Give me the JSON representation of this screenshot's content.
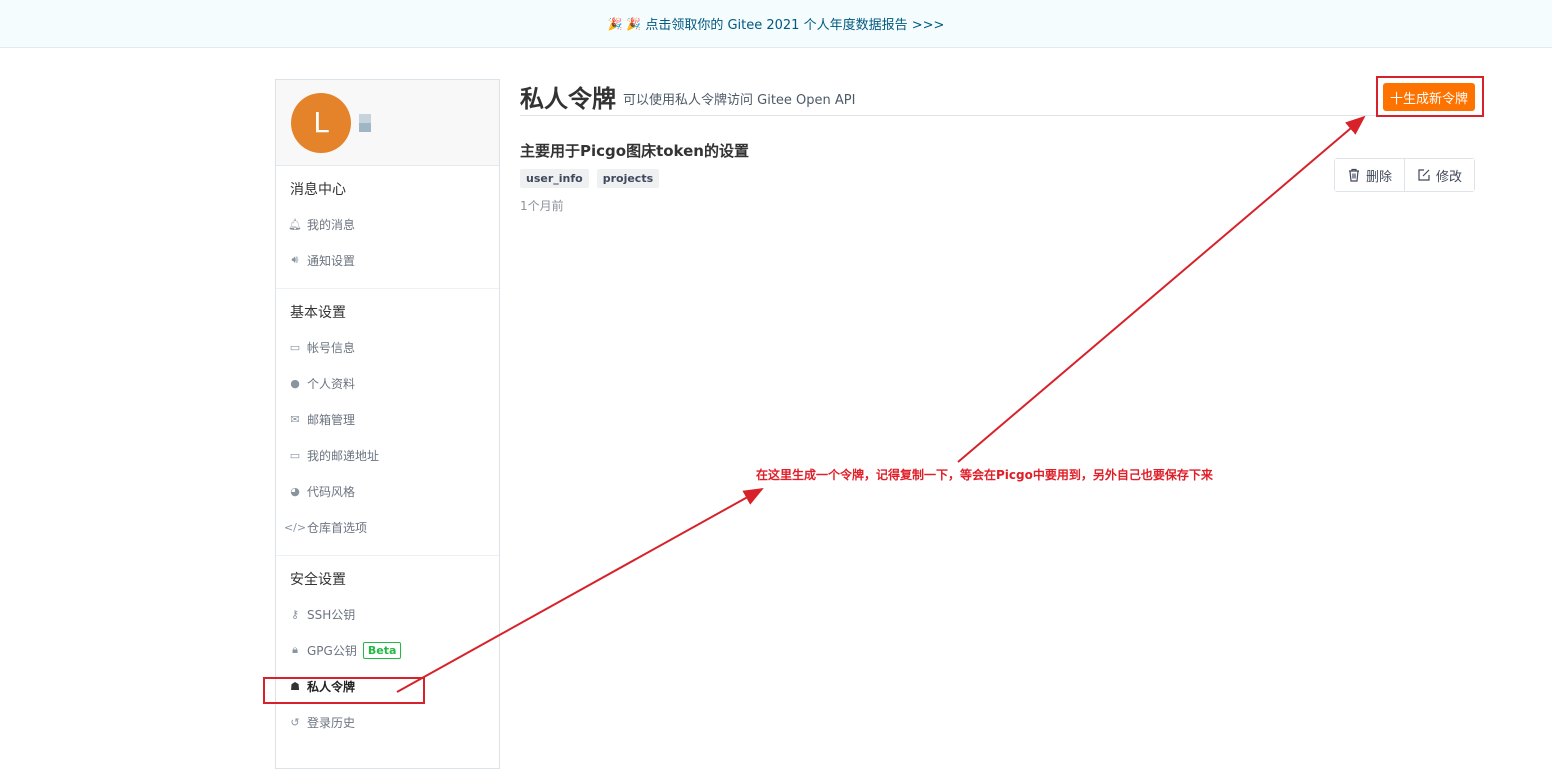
{
  "banner": {
    "emoji": "🎉 🎉",
    "text": "点击领取你的 Gitee 2021 个人年度数据报告 >>>"
  },
  "sidebar": {
    "avatar_letter": "L",
    "groups": [
      {
        "title": "消息中心",
        "items": [
          {
            "label": "我的消息",
            "icon": "bell-icon"
          },
          {
            "label": "通知设置",
            "icon": "volume-icon"
          }
        ]
      },
      {
        "title": "基本设置",
        "items": [
          {
            "label": "帐号信息",
            "icon": "id-card-icon"
          },
          {
            "label": "个人资料",
            "icon": "user-icon"
          },
          {
            "label": "邮箱管理",
            "icon": "envelope-icon"
          },
          {
            "label": "我的邮递地址",
            "icon": "address-card-icon"
          },
          {
            "label": "代码风格",
            "icon": "palette-icon"
          },
          {
            "label": "仓库首选项",
            "icon": "code-icon"
          }
        ]
      },
      {
        "title": "安全设置",
        "items": [
          {
            "label": "SSH公钥",
            "icon": "key-icon"
          },
          {
            "label": "GPG公钥",
            "icon": "lock-icon",
            "badge": "Beta"
          },
          {
            "label": "私人令牌",
            "icon": "user-secret-icon",
            "active": true
          },
          {
            "label": "登录历史",
            "icon": "history-icon"
          }
        ]
      }
    ]
  },
  "main": {
    "title": "私人令牌",
    "description": "可以使用私人令牌访问 Gitee Open API",
    "generate_button": "十生成新令牌",
    "token": {
      "name": "主要用于Picgo图床token的设置",
      "scopes": [
        "user_info",
        "projects"
      ],
      "time": "1个月前",
      "delete_label": "删除",
      "edit_label": "修改"
    }
  },
  "annotation": {
    "text": "在这里生成一个令牌，记得复制一下，等会在Picgo中要用到，另外自己也要保存下来",
    "color": "#e01e28"
  },
  "colors": {
    "accent": "#fe7300",
    "avatar": "#e5832b",
    "annotation": "#d7222b",
    "beta": "#21ba45"
  }
}
